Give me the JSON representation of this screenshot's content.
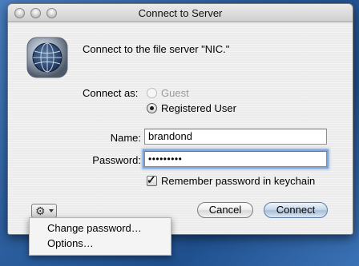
{
  "window": {
    "title": "Connect to Server"
  },
  "dialog": {
    "message": "Connect to the file server \"NIC.\"",
    "connect_as_label": "Connect as:",
    "options": [
      {
        "label": "Guest",
        "selected": false,
        "enabled": false
      },
      {
        "label": "Registered User",
        "selected": true,
        "enabled": true
      }
    ],
    "name_label": "Name:",
    "name_value": "brandond",
    "password_label": "Password:",
    "password_value": "•••••••••",
    "remember_label": "Remember password in keychain",
    "remember_checked": true,
    "cancel_label": "Cancel",
    "connect_label": "Connect"
  },
  "action_menu": {
    "icon": "gear-icon",
    "items": [
      "Change password…",
      "Options…"
    ]
  },
  "colors": {
    "focus_ring": "#7aa7df",
    "default_button": "#a9bfd9"
  }
}
